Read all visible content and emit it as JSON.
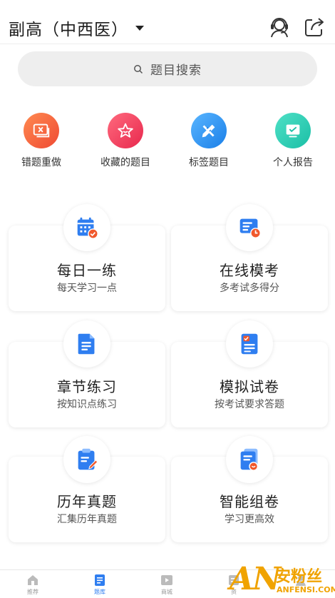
{
  "header": {
    "title": "副高（中西医）",
    "service_icon": "customer-service-icon",
    "share_icon": "share-icon"
  },
  "search": {
    "placeholder": "题目搜索",
    "icon": "search-icon"
  },
  "quick_entries": [
    {
      "label": "错题重做",
      "icon": "wrong-questions-icon",
      "color": "#ef4a33"
    },
    {
      "label": "收藏的题目",
      "icon": "star-icon",
      "color": "#e8284d"
    },
    {
      "label": "标签题目",
      "icon": "tag-icon",
      "color": "#1a7fe8"
    },
    {
      "label": "个人报告",
      "icon": "report-icon",
      "color": "#1bbfa6"
    }
  ],
  "practice_cards": [
    {
      "name": "每日一练",
      "desc": "每天学习一点",
      "icon": "calendar-icon"
    },
    {
      "name": "在线模考",
      "desc": "多考试多得分",
      "icon": "online-exam-icon"
    },
    {
      "name": "章节练习",
      "desc": "按知识点练习",
      "icon": "document-icon"
    },
    {
      "name": "模拟试卷",
      "desc": "按考试要求答题",
      "icon": "mock-paper-icon"
    },
    {
      "name": "历年真题",
      "desc": "汇集历年真题",
      "icon": "clipboard-edit-icon"
    },
    {
      "name": "智能组卷",
      "desc": "学习更高效",
      "icon": "smart-paper-icon"
    }
  ],
  "tabbar": {
    "accent": "#2f7ef0",
    "tabs": [
      {
        "label": "推荐",
        "icon": "home-icon",
        "active": false
      },
      {
        "label": "题库",
        "icon": "question-bank-icon",
        "active": true
      },
      {
        "label": "商城",
        "icon": "video-icon",
        "active": false
      },
      {
        "label": "资",
        "icon": "news-icon",
        "active": false
      },
      {
        "label": "",
        "icon": "profile-icon",
        "active": false
      }
    ]
  },
  "watermark": {
    "logo": "AN",
    "text": "安粉丝",
    "url": "ANFENSI.COM"
  }
}
